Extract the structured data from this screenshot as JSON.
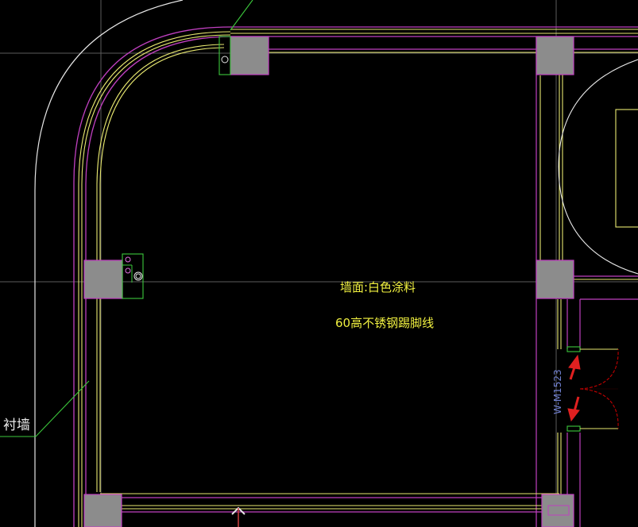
{
  "drawing": {
    "background": "#000000",
    "colors": {
      "wall_magenta": "#C040C0",
      "wall_yellow": "#E8E870",
      "white_line": "#E6E6E6",
      "column_fill": "#8C8C8C",
      "leader_green": "#3CC83C",
      "door_red": "#C00000",
      "arrow_red": "#E02020",
      "text_yellow": "#F0F040",
      "text_blue": "#7080D0"
    },
    "annotations": {
      "wall_finish": "墙面:白色涂料",
      "baseboard": "60高不锈钢踢脚线",
      "door_tag": "W-M1523",
      "lining_wall": "衬墙"
    }
  }
}
